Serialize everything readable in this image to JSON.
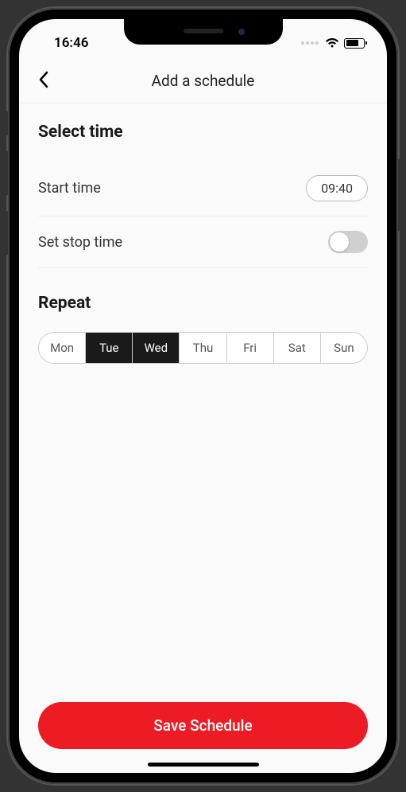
{
  "status": {
    "time": "16:46"
  },
  "header": {
    "title": "Add a schedule"
  },
  "select_time": {
    "title": "Select time",
    "start_label": "Start time",
    "start_value": "09:40",
    "stop_label": "Set stop time",
    "stop_enabled": false
  },
  "repeat": {
    "title": "Repeat",
    "days": [
      {
        "label": "Mon",
        "selected": false
      },
      {
        "label": "Tue",
        "selected": true
      },
      {
        "label": "Wed",
        "selected": true
      },
      {
        "label": "Thu",
        "selected": false
      },
      {
        "label": "Fri",
        "selected": false
      },
      {
        "label": "Sat",
        "selected": false
      },
      {
        "label": "Sun",
        "selected": false
      }
    ]
  },
  "footer": {
    "save_label": "Save Schedule"
  },
  "colors": {
    "accent": "#ed1c24",
    "selected_day_bg": "#1a1a1a"
  }
}
